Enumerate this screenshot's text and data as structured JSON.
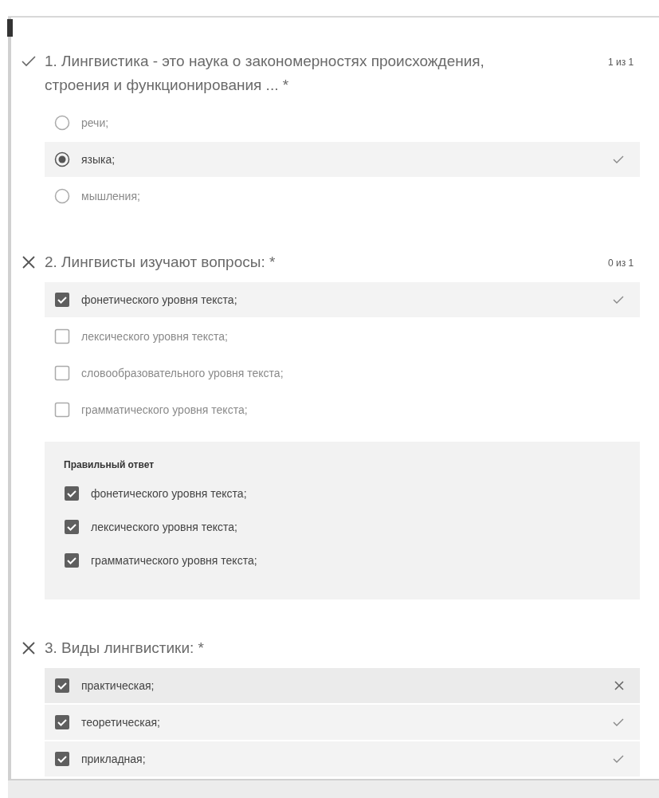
{
  "questions": [
    {
      "correct": true,
      "title": "1. Лингвистика - это наука о закономерностях происхождения, строения и функционирования ... *",
      "score": "1 из 1",
      "kind": "radio",
      "options": [
        {
          "label": "речи;",
          "selected": false
        },
        {
          "label": "языка;",
          "selected": true,
          "correct": true
        },
        {
          "label": "мышления;",
          "selected": false
        }
      ]
    },
    {
      "correct": false,
      "title": "2. Лингвисты изучают вопросы: *",
      "score": "0 из 1",
      "kind": "checkbox",
      "options": [
        {
          "label": "фонетического уровня текста;",
          "selected": true,
          "correct": true
        },
        {
          "label": "лексического уровня текста;",
          "selected": false
        },
        {
          "label": "словообразовательного уровня текста;",
          "selected": false
        },
        {
          "label": "грамматического уровня текста;",
          "selected": false
        }
      ],
      "correct_answer": {
        "heading": "Правильный ответ",
        "options": [
          {
            "label": "фонетического уровня текста;",
            "selected": true
          },
          {
            "label": "лексического уровня текста;",
            "selected": true
          },
          {
            "label": "грамматического уровня текста;",
            "selected": true
          }
        ]
      }
    },
    {
      "correct": false,
      "title": "3. Виды лингвистики: *",
      "kind": "checkbox",
      "options": [
        {
          "label": "практическая;",
          "selected": true,
          "correct": false
        },
        {
          "label": "теоретическая;",
          "selected": true,
          "correct": true
        },
        {
          "label": "прикладная;",
          "selected": true,
          "correct": true
        }
      ]
    }
  ]
}
